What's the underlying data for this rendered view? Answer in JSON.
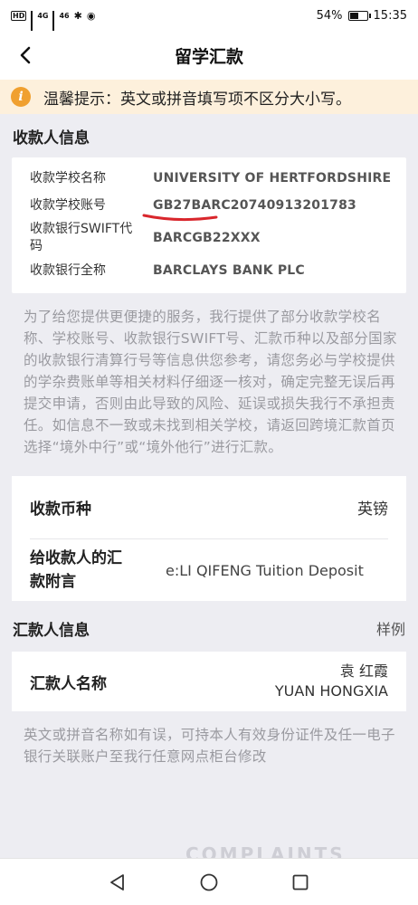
{
  "status_bar": {
    "network_labels": [
      "HD",
      "4G",
      "46"
    ],
    "battery": "54%",
    "battery_level": 0.54,
    "time": "15:35"
  },
  "header": {
    "title": "留学汇款"
  },
  "tip": {
    "text": "温馨提示：英文或拼音填写项不区分大小写。"
  },
  "payee": {
    "title": "收款人信息",
    "rows": [
      {
        "label": "收款学校名称",
        "value": "UNIVERSITY OF HERTFORDSHIRE"
      },
      {
        "label": "收款学校账号",
        "value": "GB27BARC20740913201783"
      },
      {
        "label": "收款银行SWIFT代码",
        "value": "BARCGB22XXX"
      },
      {
        "label": "收款银行全称",
        "value": "BARCLAYS BANK PLC"
      }
    ],
    "notice": "为了给您提供更便捷的服务，我行提供了部分收款学校名称、学校账号、收款银行SWIFT号、汇款币种以及部分国家的收款银行清算行号等信息供您参考，请您务必与学校提供的学杂费账单等相关材料仔细逐一核对，确定完整无误后再提交申请，否则由此导致的风险、延误或损失我行不承担责任。如信息不一致或未找到相关学校，请返回跨境汇款首页选择“境外中行”或“境外他行”进行汇款。"
  },
  "transfer": {
    "currency_label": "收款币种",
    "currency_value": "英镑",
    "memo_label": "给收款人的汇款附言",
    "memo_value": "e:LI QIFENG   Tuition Deposit"
  },
  "remitter": {
    "title": "汇款人信息",
    "sample_link": "样例",
    "name_label": "汇款人名称",
    "name_cn": "袁 红霞",
    "name_en": "YUAN HONGXIA",
    "notice": "英文或拼音名称如有误，可持本人有效身份证件及任一电子银行关联账户至我行任意网点柜台修改"
  },
  "watermark": "COMPLAINTS",
  "colors": {
    "tip_bg": "#fdf0dc",
    "tip_icon": "#f0a030",
    "underline": "#d9262c",
    "page_bg": "#ededf2"
  }
}
